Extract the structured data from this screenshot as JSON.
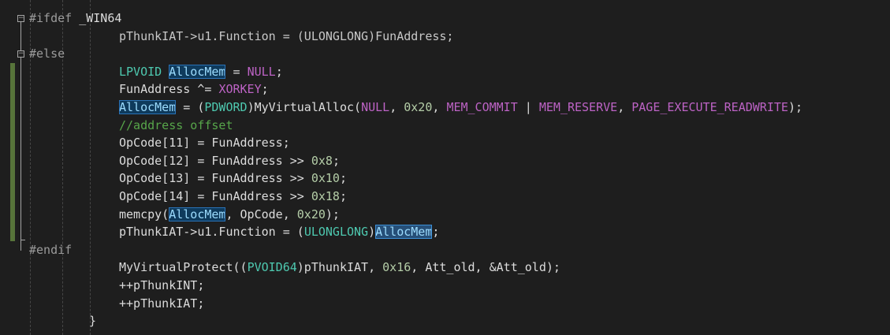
{
  "editor": {
    "lines": [
      {
        "id": "l1",
        "tokens": [
          {
            "t": "#ifdef ",
            "c": "kw"
          },
          {
            "t": "_WIN64",
            "c": "plain"
          }
        ]
      },
      {
        "id": "l2",
        "tokens": [
          {
            "t": "pThunkIAT->u1.Function = (ULONGLONG)FunAddress;",
            "c": "dim"
          }
        ]
      },
      {
        "id": "l3",
        "tokens": [
          {
            "t": "#else",
            "c": "kw"
          }
        ]
      },
      {
        "id": "l4",
        "tokens": [
          {
            "t": "LPVOID ",
            "c": "type"
          },
          {
            "t": "AllocMem",
            "c": "hl"
          },
          {
            "t": " = ",
            "c": "plain"
          },
          {
            "t": "NULL",
            "c": "macro"
          },
          {
            "t": ";",
            "c": "plain"
          }
        ]
      },
      {
        "id": "l5",
        "tokens": [
          {
            "t": "FunAddress ^= ",
            "c": "plain"
          },
          {
            "t": "XORKEY",
            "c": "macro"
          },
          {
            "t": ";",
            "c": "plain"
          }
        ]
      },
      {
        "id": "l6",
        "tokens": [
          {
            "t": "AllocMem",
            "c": "hl"
          },
          {
            "t": " = (",
            "c": "plain"
          },
          {
            "t": "PDWORD",
            "c": "type"
          },
          {
            "t": ")MyVirtualAlloc(",
            "c": "plain"
          },
          {
            "t": "NULL",
            "c": "macro"
          },
          {
            "t": ", ",
            "c": "plain"
          },
          {
            "t": "0x20",
            "c": "num"
          },
          {
            "t": ", ",
            "c": "plain"
          },
          {
            "t": "MEM_COMMIT",
            "c": "macro"
          },
          {
            "t": " | ",
            "c": "plain"
          },
          {
            "t": "MEM_RESERVE",
            "c": "macro"
          },
          {
            "t": ", ",
            "c": "plain"
          },
          {
            "t": "PAGE_EXECUTE_READWRITE",
            "c": "macro"
          },
          {
            "t": ");",
            "c": "plain"
          }
        ]
      },
      {
        "id": "l7",
        "tokens": [
          {
            "t": "//address offset",
            "c": "comment"
          }
        ]
      },
      {
        "id": "l8",
        "tokens": [
          {
            "t": "OpCode[11] = FunAddress;",
            "c": "plain"
          }
        ]
      },
      {
        "id": "l9",
        "tokens": [
          {
            "t": "OpCode[12] = FunAddress >> ",
            "c": "plain"
          },
          {
            "t": "0x8",
            "c": "num"
          },
          {
            "t": ";",
            "c": "plain"
          }
        ]
      },
      {
        "id": "l10",
        "tokens": [
          {
            "t": "OpCode[13] = FunAddress >> ",
            "c": "plain"
          },
          {
            "t": "0x10",
            "c": "num"
          },
          {
            "t": ";",
            "c": "plain"
          }
        ]
      },
      {
        "id": "l11",
        "tokens": [
          {
            "t": "OpCode[14] = FunAddress >> ",
            "c": "plain"
          },
          {
            "t": "0x18",
            "c": "num"
          },
          {
            "t": ";",
            "c": "plain"
          }
        ]
      },
      {
        "id": "l12",
        "tokens": [
          {
            "t": "memcpy(",
            "c": "plain"
          },
          {
            "t": "AllocMem",
            "c": "hl"
          },
          {
            "t": ", OpCode, ",
            "c": "plain"
          },
          {
            "t": "0x20",
            "c": "num"
          },
          {
            "t": ");",
            "c": "plain"
          }
        ]
      },
      {
        "id": "l13",
        "tokens": [
          {
            "t": "pThunkIAT->u1.Function = (",
            "c": "plain"
          },
          {
            "t": "ULONGLONG",
            "c": "type"
          },
          {
            "t": ")",
            "c": "plain"
          },
          {
            "t": "AllocMem",
            "c": "hl-sel"
          },
          {
            "t": ";",
            "c": "plain"
          }
        ]
      },
      {
        "id": "l14",
        "tokens": [
          {
            "t": "#endif",
            "c": "kw"
          }
        ]
      },
      {
        "id": "l15",
        "tokens": [
          {
            "t": "MyVirtualProtect((",
            "c": "plain"
          },
          {
            "t": "PVOID64",
            "c": "type"
          },
          {
            "t": ")pThunkIAT, ",
            "c": "plain"
          },
          {
            "t": "0x16",
            "c": "num"
          },
          {
            "t": ", Att_old, &Att_old);",
            "c": "plain"
          }
        ]
      },
      {
        "id": "l16",
        "tokens": [
          {
            "t": "++pThunkINT;",
            "c": "plain"
          }
        ]
      },
      {
        "id": "l17",
        "tokens": [
          {
            "t": "++pThunkIAT;",
            "c": "plain"
          }
        ]
      },
      {
        "id": "l18",
        "tokens": [
          {
            "t": "}",
            "c": "plain"
          }
        ]
      }
    ],
    "fold_markers": [
      {
        "line": "l1",
        "glyph": "−"
      },
      {
        "line": "l3",
        "glyph": "−"
      }
    ],
    "colors": {
      "background": "#1e1e1e",
      "preprocessor": "#9b9b9b",
      "type": "#4ec9b0",
      "macro": "#bd63c5",
      "number": "#b5cea8",
      "comment": "#57a64a",
      "text": "#dcdcdc",
      "highlight": "#0e3a5c",
      "change_bar": "#57743a"
    }
  }
}
